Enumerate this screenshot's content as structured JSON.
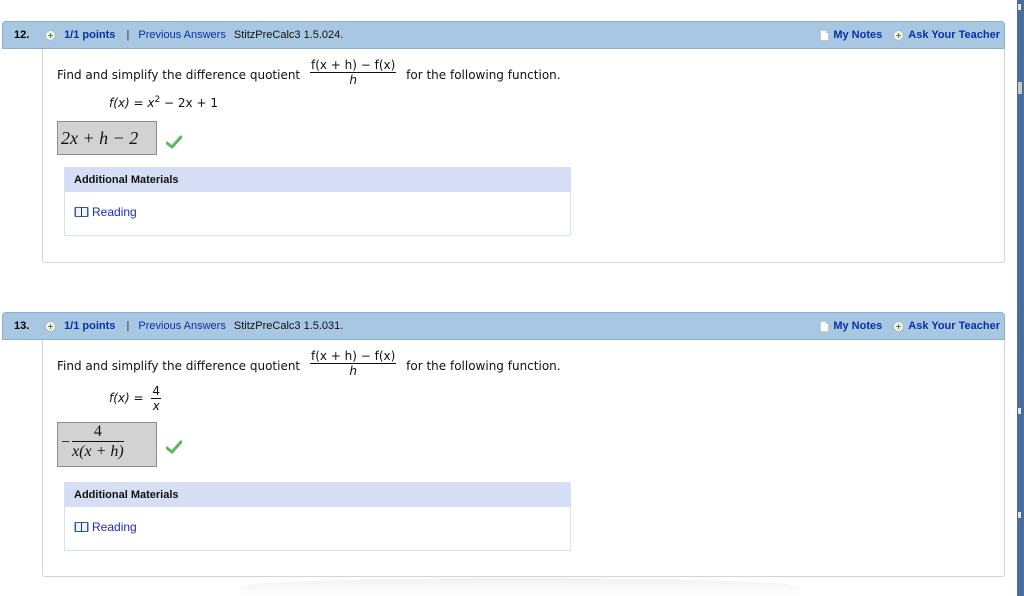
{
  "questions": [
    {
      "number": "12.",
      "points": "1/1 points",
      "separator": "|",
      "previous_answers": "Previous Answers",
      "source": "StitzPreCalc3 1.5.024.",
      "my_notes": "My Notes",
      "ask_teacher": "Ask Your Teacher",
      "prompt_before": "Find and simplify the difference quotient",
      "quotient_numerator": "f(x + h) − f(x)",
      "quotient_denominator": "h",
      "prompt_after": "for the following function.",
      "function_lhs": "f(x) = ",
      "function_parts": [
        "x",
        "2",
        " − 2x + 1"
      ],
      "answer": "2x + h − 2",
      "answer_status": "correct",
      "materials_title": "Additional Materials",
      "reading_label": "Reading"
    },
    {
      "number": "13.",
      "points": "1/1 points",
      "separator": "|",
      "previous_answers": "Previous Answers",
      "source": "StitzPreCalc3 1.5.031.",
      "my_notes": "My Notes",
      "ask_teacher": "Ask Your Teacher",
      "prompt_before": "Find and simplify the difference quotient",
      "quotient_numerator": "f(x + h) − f(x)",
      "quotient_denominator": "h",
      "prompt_after": "for the following function.",
      "function_lhs": "f(x) = ",
      "function_frac_num": "4",
      "function_frac_den": "x",
      "answer_sign": "−",
      "answer_num": "4",
      "answer_den": "x(x + h)",
      "answer_status": "correct",
      "materials_title": "Additional Materials",
      "reading_label": "Reading"
    }
  ],
  "colors": {
    "header_bg": "#a8c7e2",
    "link_blue": "#0b2fa3",
    "materials_header_bg": "#d5def4",
    "check_green": "#5cb85c",
    "answer_bg": "#d2d2d2"
  }
}
